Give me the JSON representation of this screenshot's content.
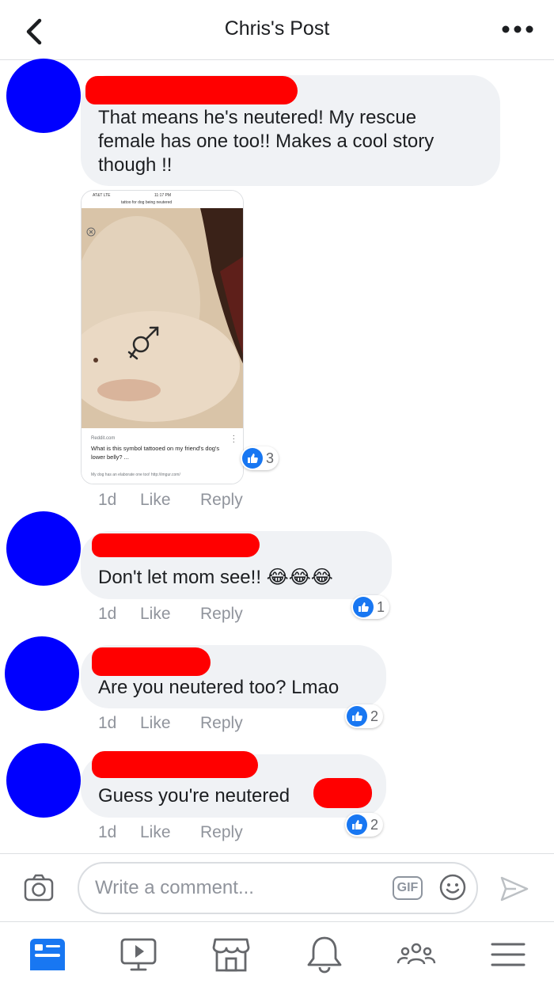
{
  "header": {
    "title": "Chris's Post",
    "back_icon": "chevron-left-icon",
    "more_icon": "more-horizontal-icon"
  },
  "comments": [
    {
      "text_lines": [
        "That means he's neutered!   My rescue",
        "female has one too!!  Makes a cool story",
        "though !!"
      ],
      "attachment": {
        "status_carrier": "AT&T  LTE",
        "status_time": "11:17 PM",
        "search_query": "tattoo for dog being neutered",
        "source": "Reddit.com",
        "title": "What is this symbol tattooed on my friend's dog's lower belly? ...",
        "description": "My dog has an elaborate one too! http://imgur.com/"
      },
      "time": "1d",
      "like_label": "Like",
      "reply_label": "Reply",
      "reaction_count": "3"
    },
    {
      "text": "Don't let mom see!!",
      "emoji": "😂😂😂",
      "time": "1d",
      "like_label": "Like",
      "reply_label": "Reply",
      "reaction_count": "1"
    },
    {
      "text": "Are you neutered too? Lmao",
      "time": "1d",
      "like_label": "Like",
      "reply_label": "Reply",
      "reaction_count": "2"
    },
    {
      "text": "Guess you're neutered",
      "time": "1d",
      "like_label": "Like",
      "reply_label": "Reply",
      "reaction_count": "2"
    }
  ],
  "composer": {
    "placeholder": "Write a comment...",
    "gif_label": "GIF",
    "camera_icon": "camera-icon",
    "emoji_icon": "smiley-icon",
    "send_icon": "send-icon"
  },
  "tabbar": {
    "items": [
      "news-feed-icon",
      "watch-icon",
      "marketplace-icon",
      "notifications-icon",
      "groups-icon",
      "menu-icon"
    ],
    "active_color": "#1877f2",
    "inactive_color": "#65676b"
  },
  "colors": {
    "avatar": "#0000ff",
    "redaction": "#ff0000",
    "bubble": "#f0f2f5",
    "like_blue": "#1877f2",
    "meta_gray": "#90949c"
  }
}
